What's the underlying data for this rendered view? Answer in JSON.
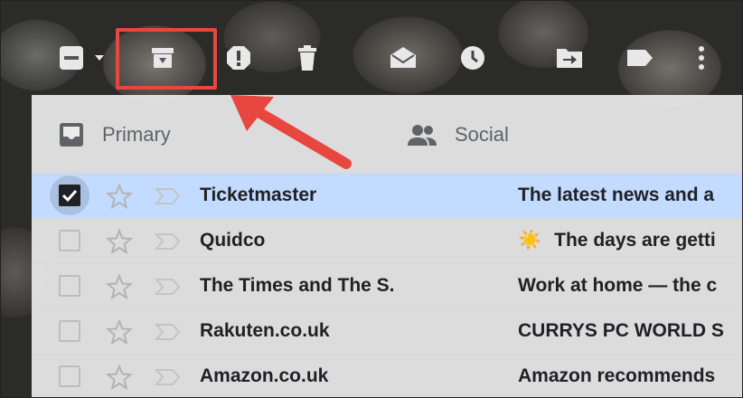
{
  "toolbar": {
    "buttons": [
      {
        "name": "select-all-checkbox",
        "icon": "minus-checkbox-icon"
      },
      {
        "name": "archive-button",
        "icon": "archive-icon"
      },
      {
        "name": "report-spam-button",
        "icon": "exclamation-icon"
      },
      {
        "name": "delete-button",
        "icon": "trash-icon"
      },
      {
        "name": "mark-as-read-button",
        "icon": "open-envelope-icon"
      },
      {
        "name": "snooze-button",
        "icon": "clock-icon"
      },
      {
        "name": "move-to-button",
        "icon": "folder-move-icon"
      },
      {
        "name": "labels-button",
        "icon": "label-icon"
      },
      {
        "name": "more-button",
        "icon": "more-vert-icon"
      }
    ]
  },
  "tabs": [
    {
      "label": "Primary",
      "icon": "inbox-icon"
    },
    {
      "label": "Social",
      "icon": "people-icon"
    }
  ],
  "emails": [
    {
      "sender": "Ticketmaster",
      "subject": "The latest news and a",
      "selected": true,
      "emoji": ""
    },
    {
      "sender": "Quidco",
      "subject": "The days are getti",
      "selected": false,
      "emoji": "☀️"
    },
    {
      "sender": "The Times and The S.",
      "subject": "Work at home — the c",
      "selected": false,
      "emoji": ""
    },
    {
      "sender": "Rakuten.co.uk",
      "subject": "CURRYS PC WORLD S",
      "selected": false,
      "emoji": ""
    },
    {
      "sender": "Amazon.co.uk",
      "subject": "Amazon recommends",
      "selected": false,
      "emoji": ""
    }
  ],
  "colors": {
    "highlight": "#e8473f",
    "selected_row": "#c2dbff",
    "icon_white": "#ffffff"
  }
}
